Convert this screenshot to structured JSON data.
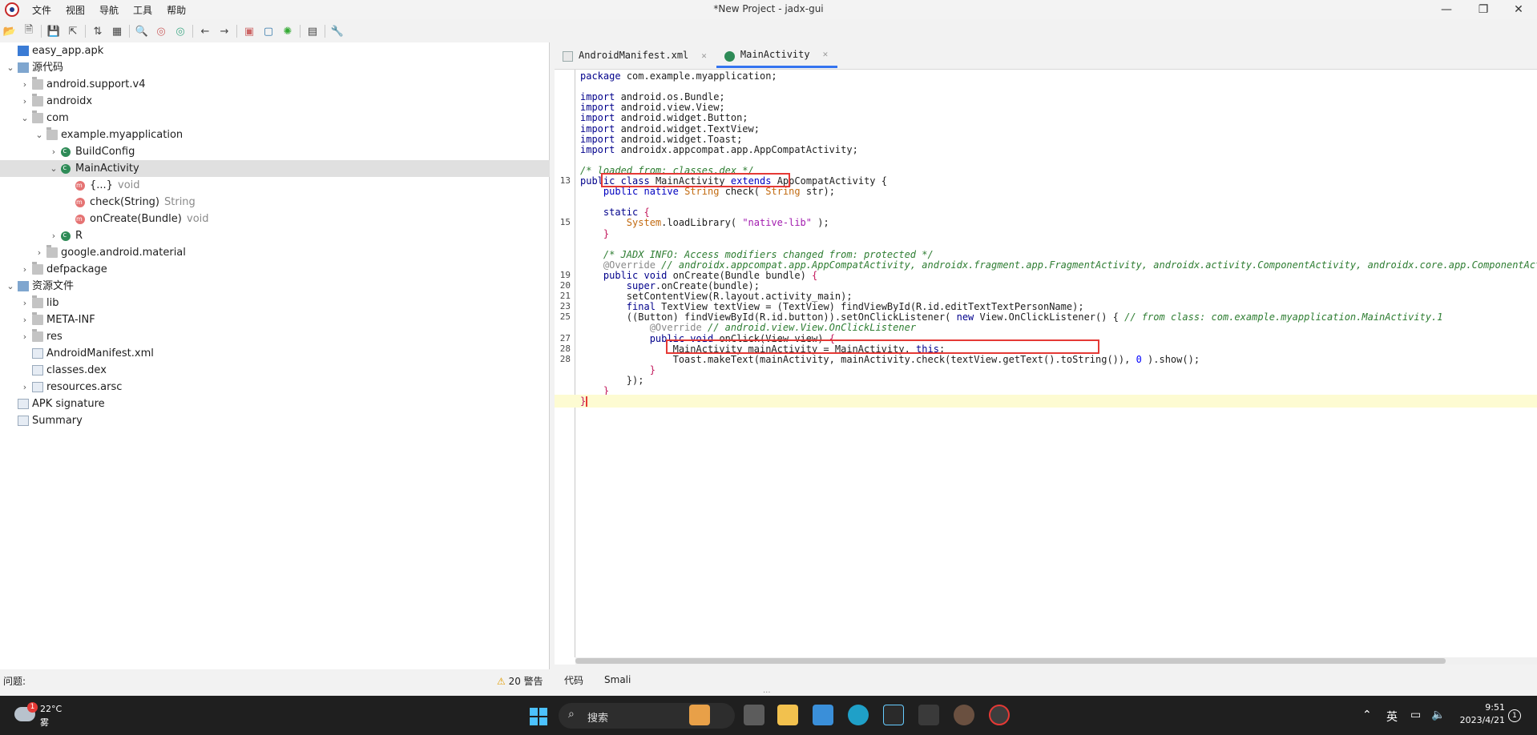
{
  "window": {
    "title": "*New Project - jadx-gui",
    "controls": [
      "—",
      "❐",
      "✕"
    ]
  },
  "menu": [
    "文件",
    "视图",
    "导航",
    "工具",
    "帮助"
  ],
  "toolbar_icons": [
    "open-icon",
    "add-files-icon",
    "save-icon",
    "export-icon",
    "sync-icon",
    "flatten-icon",
    "search-icon",
    "find-class-icon",
    "find-usage-icon",
    "back-icon",
    "forward-icon",
    "quark-icon",
    "deobfuscation-icon",
    "debug-icon",
    "log-icon",
    "preferences-icon"
  ],
  "tree": [
    {
      "label": "easy_app.apk",
      "extra": "",
      "level": 0,
      "icon": "apk",
      "twisty": ""
    },
    {
      "label": "源代码",
      "extra": "",
      "level": 0,
      "icon": "root",
      "twisty": "v"
    },
    {
      "label": "android.support.v4",
      "extra": "",
      "level": 1,
      "icon": "pkg",
      "twisty": ">"
    },
    {
      "label": "androidx",
      "extra": "",
      "level": 1,
      "icon": "pkg",
      "twisty": ">"
    },
    {
      "label": "com",
      "extra": "",
      "level": 1,
      "icon": "pkg",
      "twisty": "v"
    },
    {
      "label": "example.myapplication",
      "extra": "",
      "level": 2,
      "icon": "pkg",
      "twisty": "v"
    },
    {
      "label": "BuildConfig",
      "extra": "",
      "level": 3,
      "icon": "cls",
      "twisty": ">"
    },
    {
      "label": "MainActivity",
      "extra": "",
      "level": 3,
      "icon": "cls",
      "twisty": "v",
      "selected": true
    },
    {
      "label": "{...}",
      "extra": "void",
      "level": 4,
      "icon": "meth",
      "twisty": ""
    },
    {
      "label": "check(String)",
      "extra": "String",
      "level": 4,
      "icon": "meth",
      "twisty": ""
    },
    {
      "label": "onCreate(Bundle)",
      "extra": "void",
      "level": 4,
      "icon": "meth",
      "twisty": ""
    },
    {
      "label": "R",
      "extra": "",
      "level": 3,
      "icon": "cls",
      "twisty": ">"
    },
    {
      "label": "google.android.material",
      "extra": "",
      "level": 2,
      "icon": "pkg",
      "twisty": ">"
    },
    {
      "label": "defpackage",
      "extra": "",
      "level": 1,
      "icon": "pkg",
      "twisty": ">"
    },
    {
      "label": "资源文件",
      "extra": "",
      "level": 0,
      "icon": "root",
      "twisty": "v"
    },
    {
      "label": "lib",
      "extra": "",
      "level": 1,
      "icon": "pkg",
      "twisty": ">"
    },
    {
      "label": "META-INF",
      "extra": "",
      "level": 1,
      "icon": "pkg",
      "twisty": ">"
    },
    {
      "label": "res",
      "extra": "",
      "level": 1,
      "icon": "pkg",
      "twisty": ">"
    },
    {
      "label": "AndroidManifest.xml",
      "extra": "",
      "level": 1,
      "icon": "file",
      "twisty": ""
    },
    {
      "label": "classes.dex",
      "extra": "",
      "level": 1,
      "icon": "file",
      "twisty": ""
    },
    {
      "label": "resources.arsc",
      "extra": "",
      "level": 1,
      "icon": "file",
      "twisty": ">"
    },
    {
      "label": "APK signature",
      "extra": "",
      "level": 0,
      "icon": "file",
      "twisty": ""
    },
    {
      "label": "Summary",
      "extra": "",
      "level": 0,
      "icon": "file",
      "twisty": ""
    }
  ],
  "tabs": [
    {
      "label": "AndroidManifest.xml",
      "icon": "xml",
      "active": false
    },
    {
      "label": "MainActivity",
      "icon": "cls",
      "active": true
    }
  ],
  "code_lines": [
    {
      "n": "",
      "segs": [
        [
          "k",
          "package"
        ],
        [
          "",
          "com.example.myapplication;"
        ]
      ]
    },
    {
      "n": "",
      "segs": []
    },
    {
      "n": "",
      "segs": [
        [
          "k",
          "import"
        ],
        [
          "",
          "android.os.Bundle;"
        ]
      ]
    },
    {
      "n": "",
      "segs": [
        [
          "k",
          "import"
        ],
        [
          "",
          "android.view.View;"
        ]
      ]
    },
    {
      "n": "",
      "segs": [
        [
          "k",
          "import"
        ],
        [
          "",
          "android.widget.Button;"
        ]
      ]
    },
    {
      "n": "",
      "segs": [
        [
          "k",
          "import"
        ],
        [
          "",
          "android.widget.TextView;"
        ]
      ]
    },
    {
      "n": "",
      "segs": [
        [
          "k",
          "import"
        ],
        [
          "",
          "android.widget.Toast;"
        ]
      ]
    },
    {
      "n": "",
      "segs": [
        [
          "k",
          "import"
        ],
        [
          "",
          "androidx.appcompat.app.AppCompatActivity;"
        ]
      ]
    },
    {
      "n": "",
      "segs": []
    },
    {
      "n": "",
      "segs": [
        [
          "cm",
          "/* loaded from: classes.dex */"
        ]
      ]
    },
    {
      "n": "13",
      "segs": [
        [
          "k",
          "public"
        ],
        [
          "k",
          "class"
        ],
        [
          "",
          "MainActivity"
        ],
        [
          "kw",
          "extends"
        ],
        [
          "",
          "AppCompatActivity {"
        ]
      ]
    },
    {
      "n": "",
      "segs": [
        [
          "",
          "    "
        ],
        [
          "kw",
          "public"
        ],
        [
          "kw",
          "native"
        ],
        [
          "ty",
          "String"
        ],
        [
          "",
          "check("
        ],
        [
          "ty",
          "String"
        ],
        [
          "",
          "str);"
        ]
      ]
    },
    {
      "n": "",
      "segs": []
    },
    {
      "n": "",
      "segs": [
        [
          "",
          "    "
        ],
        [
          "k",
          "static"
        ],
        [
          "br",
          "{"
        ]
      ]
    },
    {
      "n": "15",
      "segs": [
        [
          "",
          "        "
        ],
        [
          "ty",
          "System"
        ],
        [
          "",
          ".loadLibrary("
        ],
        [
          "st",
          "\"native-lib\""
        ],
        [
          "",
          ");"
        ]
      ]
    },
    {
      "n": "",
      "segs": [
        [
          "",
          "    "
        ],
        [
          "br",
          "}"
        ]
      ]
    },
    {
      "n": "",
      "segs": []
    },
    {
      "n": "",
      "segs": [
        [
          "",
          "    "
        ],
        [
          "cm",
          "/* JADX INFO: Access modifiers changed from: protected */"
        ]
      ]
    },
    {
      "n": "",
      "segs": [
        [
          "",
          "    "
        ],
        [
          "an",
          "@Override"
        ],
        [
          "cm",
          "// androidx.appcompat.app.AppCompatActivity, androidx.fragment.app.FragmentActivity, androidx.activity.ComponentActivity, androidx.core.app.ComponentActivity, android.app.Activity"
        ]
      ]
    },
    {
      "n": "19",
      "segs": [
        [
          "",
          "    "
        ],
        [
          "k",
          "public"
        ],
        [
          "k",
          "void"
        ],
        [
          "",
          "onCreate(Bundle bundle)"
        ],
        [
          "br",
          "{"
        ]
      ]
    },
    {
      "n": "20",
      "segs": [
        [
          "",
          "        "
        ],
        [
          "k",
          "super"
        ],
        [
          "",
          ".onCreate(bundle);"
        ]
      ]
    },
    {
      "n": "21",
      "segs": [
        [
          "",
          "        setContentView(R.layout.activity_main);"
        ]
      ]
    },
    {
      "n": "23",
      "segs": [
        [
          "",
          "        "
        ],
        [
          "k",
          "final"
        ],
        [
          "",
          "TextView textView = (TextView) findViewById(R.id.editTextTextPersonName);"
        ]
      ]
    },
    {
      "n": "25",
      "segs": [
        [
          "",
          "        ((Button) findViewById(R.id.button)).setOnClickListener("
        ],
        [
          "k",
          "new"
        ],
        [
          "",
          "View.OnClickListener() {"
        ],
        [
          "cm",
          "// from class: com.example.myapplication.MainActivity.1"
        ]
      ]
    },
    {
      "n": "",
      "segs": [
        [
          "",
          "            "
        ],
        [
          "an",
          "@Override"
        ],
        [
          "cm",
          "// android.view.View.OnClickListener"
        ]
      ]
    },
    {
      "n": "27",
      "segs": [
        [
          "",
          "            "
        ],
        [
          "k",
          "public"
        ],
        [
          "k",
          "void"
        ],
        [
          "",
          "onClick(View view)"
        ],
        [
          "br",
          "{"
        ]
      ]
    },
    {
      "n": "28",
      "segs": [
        [
          "",
          "                MainActivity mainActivity = MainActivity."
        ],
        [
          "k",
          "this"
        ],
        [
          "",
          ";"
        ]
      ]
    },
    {
      "n": "28",
      "segs": [
        [
          "",
          "                Toast.makeText(mainActivity, mainActivity.check(textView.getText().toString()), "
        ],
        [
          "nm",
          "0"
        ],
        [
          "",
          ").show();"
        ]
      ]
    },
    {
      "n": "",
      "segs": [
        [
          "",
          "            "
        ],
        [
          "br",
          "}"
        ]
      ]
    },
    {
      "n": "",
      "segs": [
        [
          "",
          "        });"
        ]
      ]
    },
    {
      "n": "",
      "segs": [
        [
          "",
          "    "
        ],
        [
          "br",
          "}"
        ]
      ]
    },
    {
      "n": "",
      "segs": [
        [
          "br",
          "}"
        ]
      ]
    }
  ],
  "status": {
    "problems_label": "问题:",
    "warnings": "20 警告"
  },
  "bottom_tabs": [
    "代码",
    "Smali"
  ],
  "taskbar": {
    "weather_temp": "22°C",
    "weather_cond": "雾",
    "weather_badge": "1",
    "search_placeholder": "搜索",
    "ime": "英",
    "time": "9:51",
    "date": "2023/4/21",
    "notifications": "1"
  }
}
